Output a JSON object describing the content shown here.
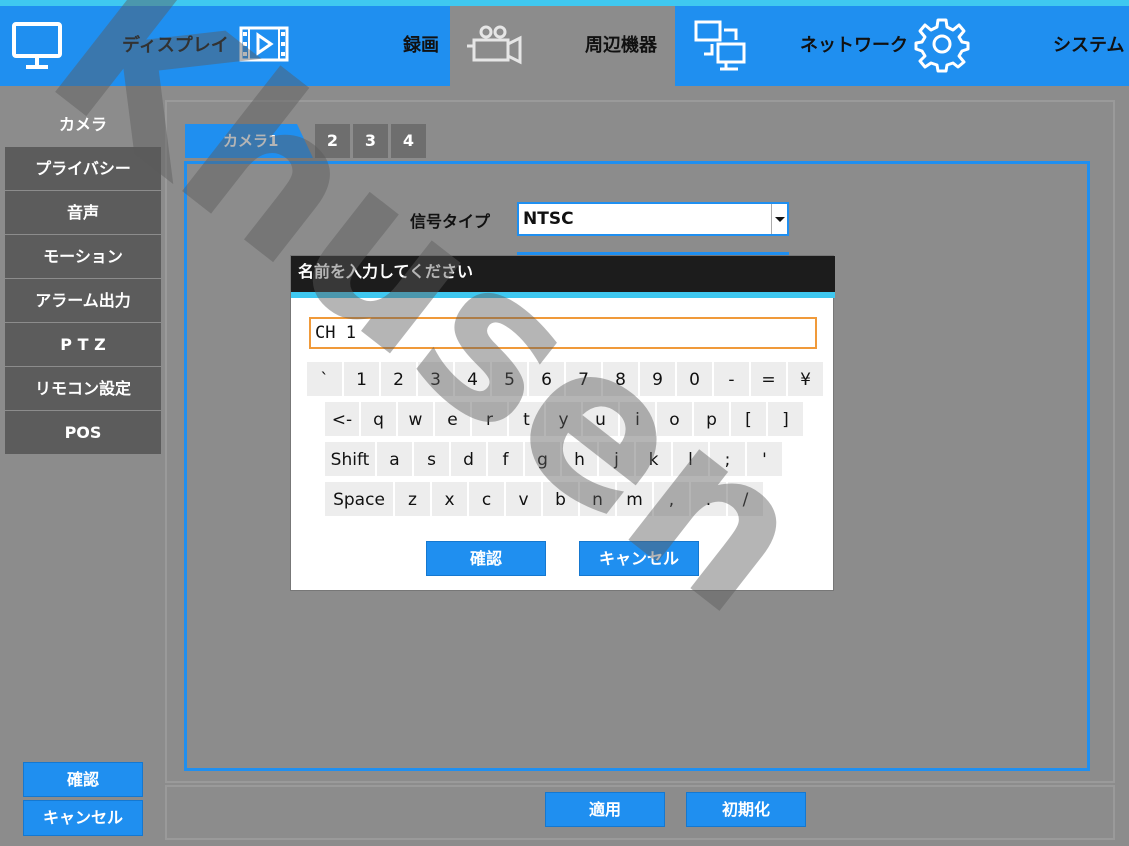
{
  "topnav": {
    "items": [
      {
        "label": "ディスプレイ",
        "icon": "monitor-icon"
      },
      {
        "label": "録画",
        "icon": "film-icon"
      },
      {
        "label": "周辺機器",
        "icon": "camera-icon"
      },
      {
        "label": "ネットワーク",
        "icon": "network-icon"
      },
      {
        "label": "システム",
        "icon": "gear-icon"
      }
    ]
  },
  "sidebar": {
    "items": [
      {
        "label": "カメラ"
      },
      {
        "label": "プライバシー"
      },
      {
        "label": "音声"
      },
      {
        "label": "モーション"
      },
      {
        "label": "アラーム出力"
      },
      {
        "label": "P T Z"
      },
      {
        "label": "リモコン設定"
      },
      {
        "label": "POS"
      }
    ],
    "confirm_label": "確認",
    "cancel_label": "キャンセル"
  },
  "tabs": {
    "camera_label": "カメラ1",
    "numbers": [
      "2",
      "3",
      "4"
    ]
  },
  "form": {
    "signal_type_label": "信号タイプ",
    "signal_type_value": "NTSC"
  },
  "dialog": {
    "title": "名前を入力してください",
    "input_value": "CH 1",
    "keyboard": {
      "row1": [
        "`",
        "1",
        "2",
        "3",
        "4",
        "5",
        "6",
        "7",
        "8",
        "9",
        "0",
        "-",
        "=",
        "¥"
      ],
      "row2": [
        "<-",
        "q",
        "w",
        "e",
        "r",
        "t",
        "y",
        "u",
        "i",
        "o",
        "p",
        "[",
        "]"
      ],
      "row3": [
        "Shift",
        "a",
        "s",
        "d",
        "f",
        "g",
        "h",
        "j",
        "k",
        "l",
        ";",
        "'"
      ],
      "row4": [
        "Space",
        "z",
        "x",
        "c",
        "v",
        "b",
        "n",
        "m",
        ",",
        ".",
        "/"
      ]
    },
    "confirm_label": "確認",
    "cancel_label": "キャンセル"
  },
  "footer": {
    "apply_label": "適用",
    "reset_label": "初期化"
  },
  "watermark": {
    "text": "Khusen"
  },
  "colors": {
    "accent": "#1f8ff0",
    "topbar_line": "#3fc8f0",
    "background": "#8c8c8c",
    "input_border": "#f09a3a"
  }
}
